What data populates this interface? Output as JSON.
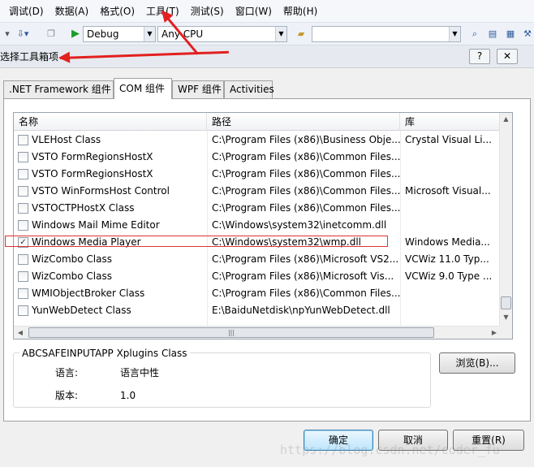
{
  "menu": [
    "调试(D)",
    "数据(A)",
    "格式(O)",
    "工具(T)",
    "测试(S)",
    "窗口(W)",
    "帮助(H)"
  ],
  "toolbar": {
    "config": "Debug",
    "platform": "Any CPU"
  },
  "dialog": {
    "title": "选择工具箱项",
    "help_button": "?",
    "tabs": [
      ".NET Framework 组件",
      "COM 组件",
      "WPF 组件",
      "Activities"
    ],
    "active_tab": 1,
    "columns": [
      "名称",
      "路径",
      "库"
    ],
    "rows": [
      {
        "checked": false,
        "name": "VLEHost Class",
        "path": "C:\\Program Files (x86)\\Business Obje...",
        "lib": "Crystal Visual Li..."
      },
      {
        "checked": false,
        "name": "VSTO FormRegionsHostX",
        "path": "C:\\Program Files (x86)\\Common Files...",
        "lib": ""
      },
      {
        "checked": false,
        "name": "VSTO FormRegionsHostX",
        "path": "C:\\Program Files (x86)\\Common Files...",
        "lib": ""
      },
      {
        "checked": false,
        "name": "VSTO WinFormsHost Control",
        "path": "C:\\Program Files (x86)\\Common Files...",
        "lib": "Microsoft Visual..."
      },
      {
        "checked": false,
        "name": "VSTOCTPHostX Class",
        "path": "C:\\Program Files (x86)\\Common Files...",
        "lib": ""
      },
      {
        "checked": false,
        "name": "Windows Mail Mime Editor",
        "path": "C:\\Windows\\system32\\inetcomm.dll",
        "lib": ""
      },
      {
        "checked": true,
        "name": "Windows Media Player",
        "path": "C:\\Windows\\system32\\wmp.dll",
        "lib": "Windows Media..."
      },
      {
        "checked": false,
        "name": "WizCombo Class",
        "path": "C:\\Program Files (x86)\\Microsoft VS2...",
        "lib": "VCWiz 11.0 Typ..."
      },
      {
        "checked": false,
        "name": "WizCombo Class",
        "path": "C:\\Program Files (x86)\\Microsoft Vis...",
        "lib": "VCWiz 9.0 Type ..."
      },
      {
        "checked": false,
        "name": "WMIObjectBroker Class",
        "path": "C:\\Program Files (x86)\\Common Files...",
        "lib": ""
      },
      {
        "checked": false,
        "name": "YunWebDetect Class",
        "path": "E:\\BaiduNetdisk\\npYunWebDetect.dll",
        "lib": ""
      }
    ],
    "check_mark": "✓",
    "details": {
      "title": "ABCSAFEINPUTAPP Xplugins Class",
      "language_label": "语言:",
      "language_value": "语言中性",
      "version_label": "版本:",
      "version_value": "1.0"
    },
    "browse_button": "浏览(B)...",
    "ok_button": "确定",
    "cancel_button": "取消",
    "reset_button": "重置(R)"
  },
  "watermark": "https://blog.csdn.net/coder_fu"
}
